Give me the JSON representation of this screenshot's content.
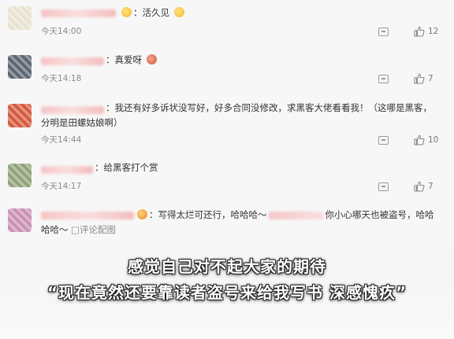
{
  "comments": [
    {
      "text": "活久见",
      "time": "今天14:00",
      "likes": "12",
      "avatar_color": "#e7e2cf",
      "emojis": [
        "yellow-face-icon",
        "cat-face-icon"
      ]
    },
    {
      "text": "真爱呀",
      "time": "今天14:18",
      "likes": "7",
      "avatar_color": "#5a6470"
    },
    {
      "text": "我还有好多诉状没写好，好多合同没修改，求黑客大佬看看我！（这哪是黑客，分明是田螺姑娘啊）",
      "time": "今天14:44",
      "likes": "10",
      "avatar_color": "#d6573c"
    },
    {
      "text": "给黑客打个赏",
      "time": "今天14:17",
      "likes": "7",
      "avatar_color": "#8fa27a"
    },
    {
      "text_a": "写得太烂可还行，哈哈哈～",
      "text_b": "你小心哪天也被盗号，哈哈哈哈～",
      "link": "评论配图",
      "avatar_color": "#c98fb3"
    }
  ],
  "subtitle": {
    "line1": "感觉自己对不起大家的期待",
    "line2": "“现在竟然还要靠读者盗号来给我写书 深感愧疚”"
  }
}
